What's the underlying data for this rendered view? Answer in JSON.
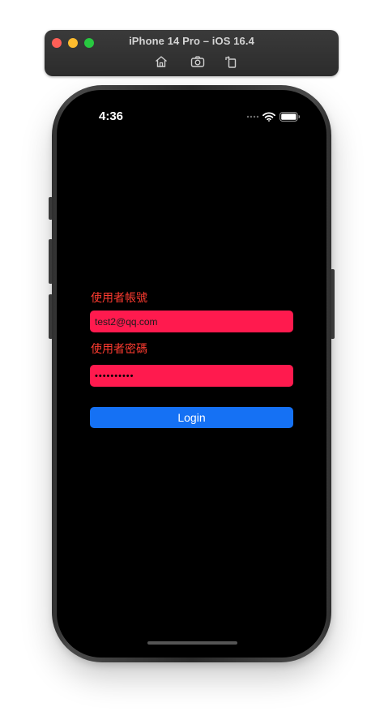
{
  "simulator": {
    "title": "iPhone 14 Pro – iOS 16.4",
    "tools": [
      "home-icon",
      "screenshot-icon",
      "rotate-icon"
    ]
  },
  "status_bar": {
    "time": "4:36",
    "icons": [
      "signal-dots-icon",
      "wifi-icon",
      "battery-icon"
    ]
  },
  "form": {
    "account_label": "使用者帳號",
    "account_value": "test2@qq.com",
    "password_label": "使用者密碼",
    "password_value": "••••••••••",
    "login_label": "Login"
  },
  "colors": {
    "label": "#ff3b30",
    "field_bg": "#ff1a4e",
    "button_bg": "#1571f4",
    "screen_bg": "#000000"
  }
}
